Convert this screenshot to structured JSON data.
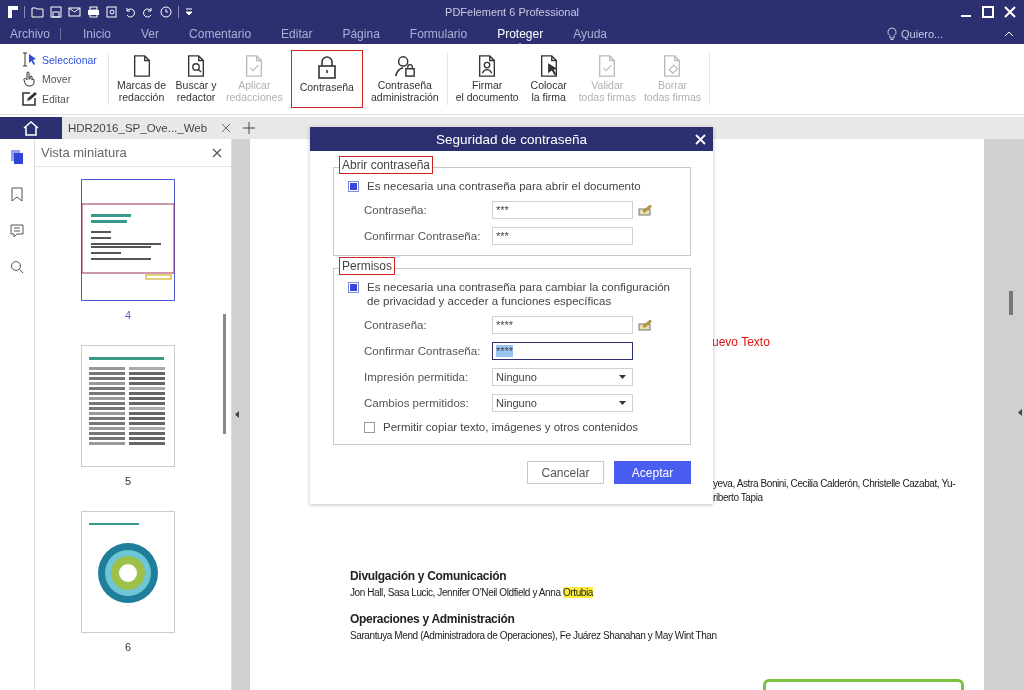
{
  "window": {
    "title": "PDFelement 6 Professional"
  },
  "menu_tabs": [
    {
      "label": "Archivo",
      "selected": false
    },
    {
      "label": "Inicio",
      "selected": false
    },
    {
      "label": "Ver",
      "selected": false
    },
    {
      "label": "Comentario",
      "selected": false
    },
    {
      "label": "Editar",
      "selected": false
    },
    {
      "label": "Página",
      "selected": false
    },
    {
      "label": "Formulario",
      "selected": false
    },
    {
      "label": "Proteger",
      "selected": true
    },
    {
      "label": "Ayuda",
      "selected": false
    }
  ],
  "tell_me": "Quiero...",
  "ribbon": {
    "tools": [
      {
        "label": "Seleccionar",
        "selected": true
      },
      {
        "label": "Mover",
        "selected": false
      },
      {
        "label": "Editar",
        "selected": false
      }
    ],
    "buttons": [
      {
        "label": "Marcas de\nredacción",
        "disabled": false,
        "highlighted": false
      },
      {
        "label": "Buscar y\nredactor",
        "disabled": false,
        "highlighted": false
      },
      {
        "label": "Aplicar\nredacciones",
        "disabled": true,
        "highlighted": false
      },
      {
        "label": "Contraseña",
        "disabled": false,
        "highlighted": true
      },
      {
        "label": "Contraseña\nadministración",
        "disabled": false,
        "highlighted": false
      },
      {
        "label": "Firmar\nel documento",
        "disabled": false,
        "highlighted": false
      },
      {
        "label": "Colocar\nla firma",
        "disabled": false,
        "highlighted": false
      },
      {
        "label": "Validar\ntodas firmas",
        "disabled": true,
        "highlighted": false
      },
      {
        "label": "Borrar\ntodas firmas",
        "disabled": true,
        "highlighted": false
      }
    ]
  },
  "document_tabs": [
    {
      "label": "HDR2016_SP_Ove..._Web"
    }
  ],
  "sidebar": {
    "title": "Vista miniatura",
    "thumbnails": [
      {
        "page": "4",
        "selected": true
      },
      {
        "page": "5",
        "selected": false
      },
      {
        "page": "6",
        "selected": false
      }
    ]
  },
  "document": {
    "red_text": "uevo Texto",
    "lines": [
      "yeva, Astra Bonini, Cecilia Calderón, Christelle Cazabat, Yu-",
      "riberto Tapia"
    ],
    "sections": [
      {
        "heading": "Divulgación y Comunicación",
        "parts": [
          {
            "text": "Jon Hall, Sasa Lucic, Jennifer O’Neil Oldfield y Anna ",
            "highlighted": false
          },
          {
            "text": "Ortubia",
            "highlighted": true
          }
        ]
      },
      {
        "heading": "Operaciones y Administración",
        "parts": [
          {
            "text": "Sarantuya Mend (Administradora de Operaciones), Fe Juárez Shanahan y May Wint Than",
            "highlighted": false
          }
        ]
      }
    ]
  },
  "dialog": {
    "title": "Seguridad de contraseña",
    "sections": [
      {
        "legend": "Abrir contraseña",
        "highlighted": true,
        "checkbox": {
          "label": "Es necesaria una contraseña para abrir el documento",
          "checked": true
        },
        "fields": [
          {
            "label": "Contraseña:",
            "kind": "password",
            "value": "***",
            "focused": false
          },
          {
            "label": "Confirmar Contraseña:",
            "kind": "confirm",
            "value": "***",
            "focused": false
          }
        ]
      },
      {
        "legend": "Permisos",
        "highlighted": true,
        "checkbox": {
          "label": "Es necesaria una contraseña para cambiar la configuración de privacidad y acceder a funciones específicas",
          "checked": true
        },
        "fields": [
          {
            "label": "Contraseña:",
            "kind": "password",
            "value": "****",
            "focused": false
          },
          {
            "label": "Confirmar Contraseña:",
            "kind": "confirm",
            "value": "****",
            "focused": true
          },
          {
            "label": "Impresión permitida:",
            "kind": "select",
            "value": "Ninguno"
          },
          {
            "label": "Cambios permitidos:",
            "kind": "select",
            "value": "Ninguno"
          }
        ],
        "option": {
          "label": "Permitir copiar texto, imágenes y otros contenidos",
          "checked": false
        }
      }
    ],
    "buttons": [
      {
        "label": "Cancelar",
        "primary": false
      },
      {
        "label": "Aceptar",
        "primary": true
      }
    ]
  }
}
